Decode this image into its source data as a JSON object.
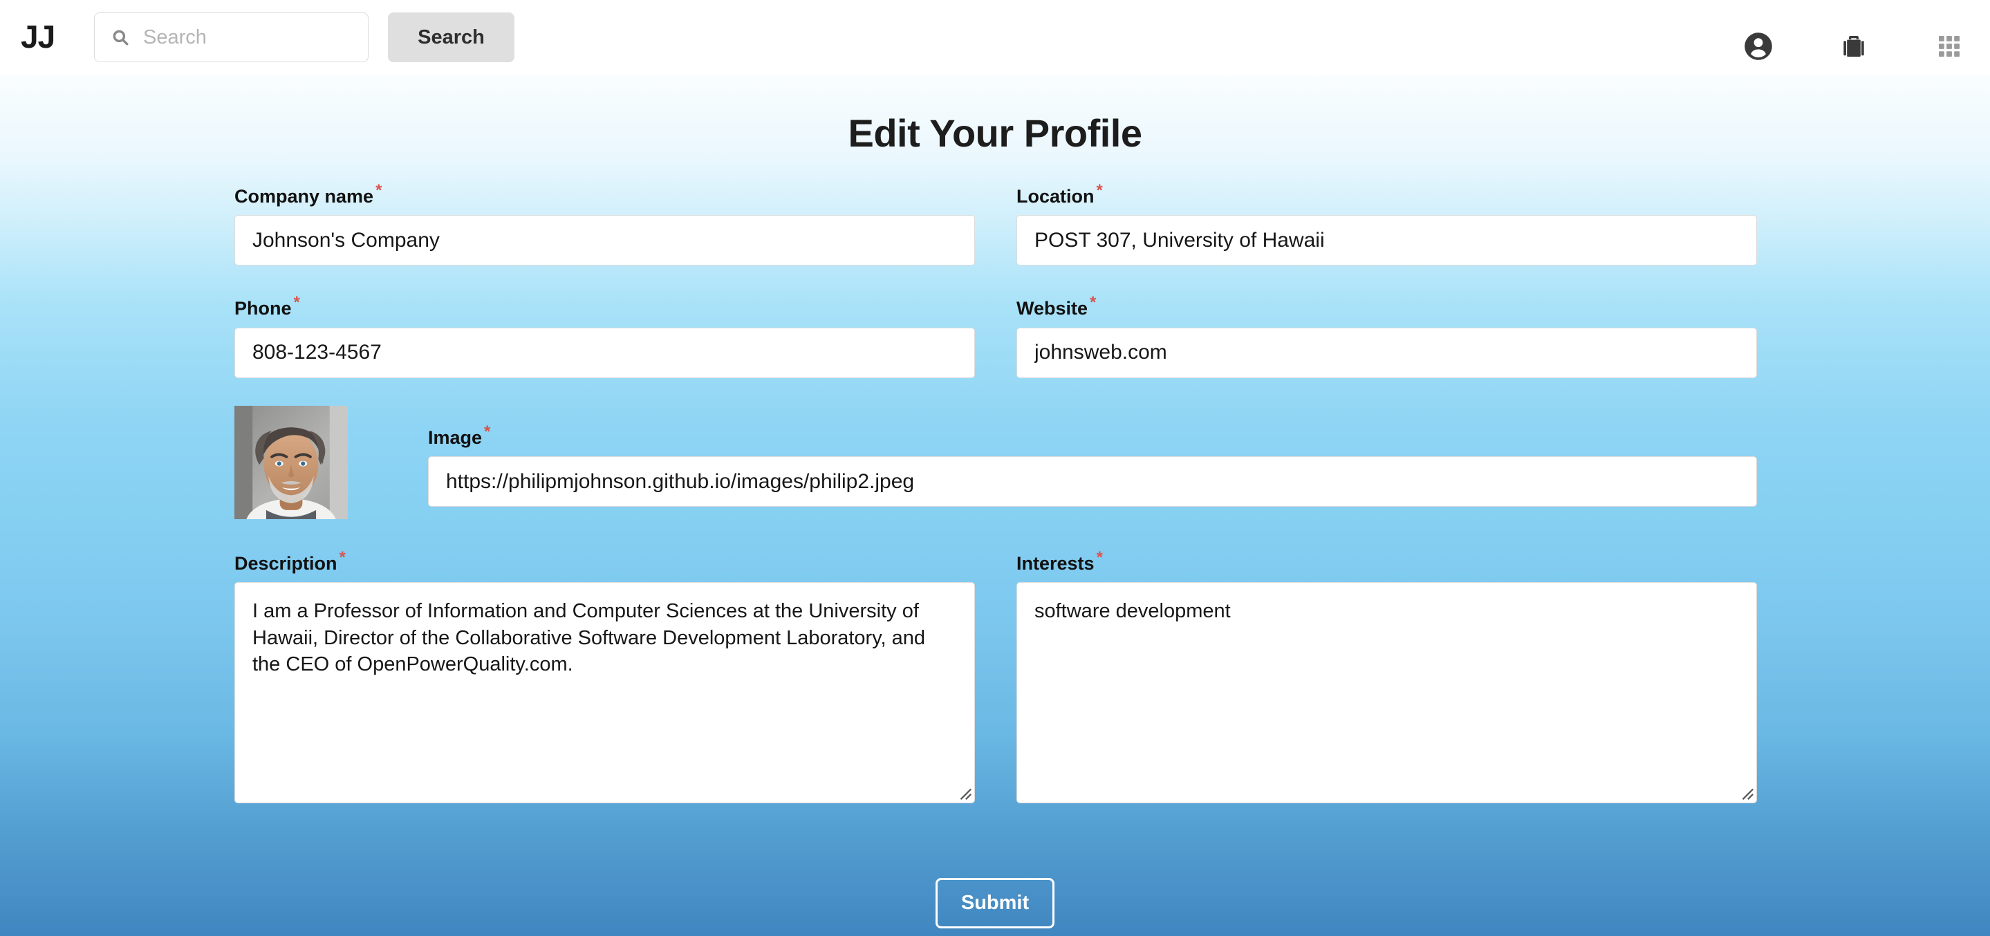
{
  "header": {
    "brand": "JJ",
    "search": {
      "placeholder": "Search",
      "value": "",
      "icon": "search-icon"
    },
    "search_button_label": "Search",
    "icons": [
      {
        "name": "user-circle-icon",
        "color": "#3a3a3a"
      },
      {
        "name": "briefcase-icon",
        "color": "#3a3a3a"
      },
      {
        "name": "grid-apps-icon",
        "color": "#9a9a9a"
      }
    ]
  },
  "page_title": "Edit Your Profile",
  "required_marker": "*",
  "form": {
    "fields": {
      "company_name": {
        "label": "Company name",
        "value": "Johnson's Company",
        "required": true
      },
      "location": {
        "label": "Location",
        "value": "POST 307, University of Hawaii",
        "required": true
      },
      "phone": {
        "label": "Phone",
        "value": "808-123-4567",
        "required": true
      },
      "website": {
        "label": "Website",
        "value": "johnsweb.com",
        "required": true
      },
      "image": {
        "label": "Image",
        "value": "https://philipmjohnson.github.io/images/philip2.jpeg",
        "required": true
      },
      "description": {
        "label": "Description",
        "value": "I am a Professor of Information and Computer Sciences at the University of Hawaii, Director of the Collaborative Software Development Laboratory, and the CEO of OpenPowerQuality.com.",
        "required": true
      },
      "interests": {
        "label": "Interests",
        "value": "software development",
        "required": true
      }
    },
    "submit_label": "Submit"
  },
  "colors": {
    "required_asterisk": "#d9534f",
    "gradient_top": "#ffffff",
    "gradient_mid": "#8ed4f4",
    "gradient_bottom": "#4086c0",
    "search_button_bg": "#dfdfdf",
    "submit_border": "#ffffff"
  }
}
